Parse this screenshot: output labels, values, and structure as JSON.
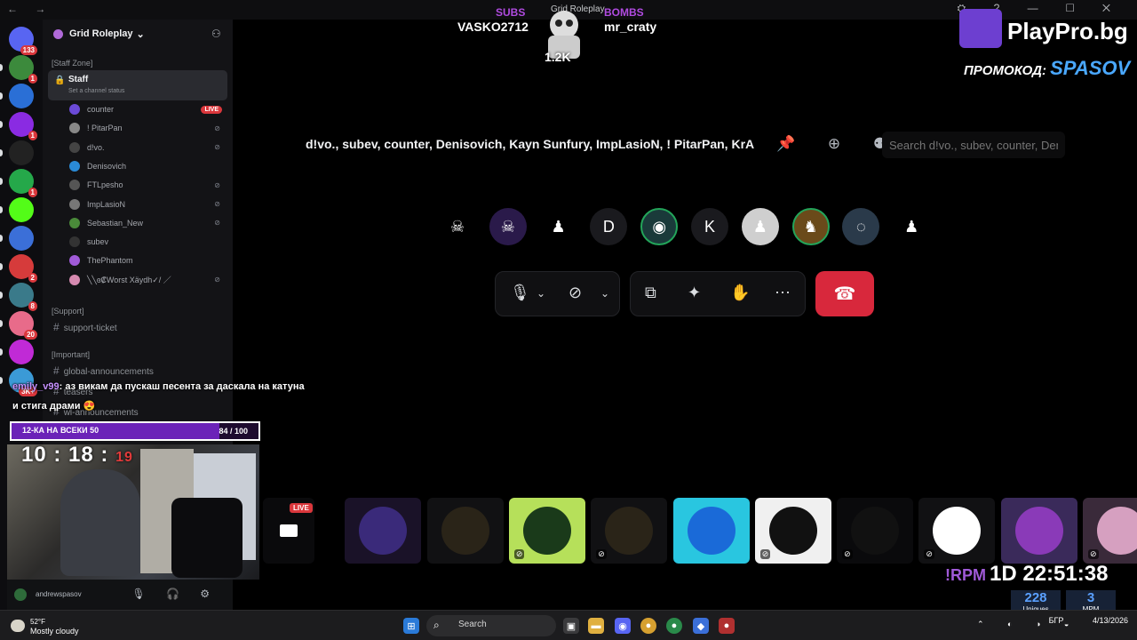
{
  "titlebar": {
    "title": "Grid Roleplay"
  },
  "guilds": [
    {
      "badge": "133",
      "color": "#5865f2"
    },
    {
      "badge": "1",
      "color": "#3c8a3c"
    },
    {
      "badge": "",
      "color": "#2a6fd6"
    },
    {
      "badge": "1",
      "color": "#8a2be2"
    },
    {
      "badge": "",
      "color": "#222"
    },
    {
      "badge": "1",
      "color": "#25a84a"
    },
    {
      "badge": "",
      "color": "#53fc18"
    },
    {
      "badge": "",
      "color": "#3b6fd8"
    },
    {
      "badge": "2",
      "color": "#d63b3b"
    },
    {
      "badge": "8",
      "color": "#3a7a8a"
    },
    {
      "badge": "20",
      "color": "#e86b8a"
    },
    {
      "badge": "",
      "color": "#c02ad6"
    },
    {
      "badge": "3K+",
      "color": "#3b9ad6"
    }
  ],
  "server": {
    "name": "Grid Roleplay"
  },
  "categories": {
    "staff_zone": "[Staff Zone]",
    "support": "[Support]",
    "important": "[Important]"
  },
  "staff_channel": {
    "name": "Staff",
    "status": "Set a channel status"
  },
  "members": [
    {
      "name": "counter",
      "live": "LIVE",
      "color": "#6b4ad8"
    },
    {
      "name": "! PitarPan",
      "color": "#888"
    },
    {
      "name": "d!vo.",
      "color": "#444"
    },
    {
      "name": "Denisovich",
      "color": "#2a8ad6"
    },
    {
      "name": "FTLpesho",
      "color": "#555"
    },
    {
      "name": "ImpLasioN",
      "color": "#777"
    },
    {
      "name": "Sebastian_New",
      "color": "#4a8a3a"
    },
    {
      "name": "subev",
      "color": "#333"
    },
    {
      "name": "ThePhantom",
      "color": "#a05ad8"
    },
    {
      "name": "╲╲ɞ₡Worst Xäydh✓/ ／",
      "color": "#d68ab0"
    }
  ],
  "text_channels": {
    "support_ticket": "support-ticket",
    "global_announcements": "global-announcements",
    "teasers": "teasers",
    "wl_announcements": "wl-announcements"
  },
  "chat": {
    "user": "emily_v99",
    "message": ": аз викам да пускаш песента за даскала на катуна и стига драми 😍"
  },
  "goal": {
    "label": "12-КА НА ВСЕКИ 50",
    "count": "84 / 100",
    "progress": 0.84
  },
  "timer": {
    "hm": "10 : 18 :",
    "sec": "19"
  },
  "user_panel": {
    "username": "andrewspasov"
  },
  "overlay": {
    "subs_label": "SUBS",
    "bombs_label": "BOMBS",
    "top_sub": "VASKO2712",
    "top_bomb": "mr_craty",
    "mascot_count": "1.2K"
  },
  "brand": {
    "name": "PlayPro.bg",
    "promo_label": "ПРОМОКОД:",
    "promo_code": "SPASOV"
  },
  "call": {
    "header": "d!vo., subev, counter, Denisovich, Kayn Sunfury, ImpLasioN, ! PitarPan, KrA",
    "search_placeholder": "Search d!vo., subev, counter, Denisovich"
  },
  "tile_live": "LIVE",
  "clock": {
    "rpm": "!RPM",
    "time": "1D 22:51:38"
  },
  "stats": [
    {
      "value": "228",
      "label": "Uniques"
    },
    {
      "value": "3",
      "label": "MPM"
    }
  ],
  "taskbar": {
    "temp": "52°F",
    "weather": "Mostly cloudy",
    "search": "Search",
    "lang": "БГР",
    "date": "4/13/2026"
  },
  "colors": {
    "hangup": "#d8283c",
    "live": "#da373c",
    "accent": "#6b22b8"
  }
}
